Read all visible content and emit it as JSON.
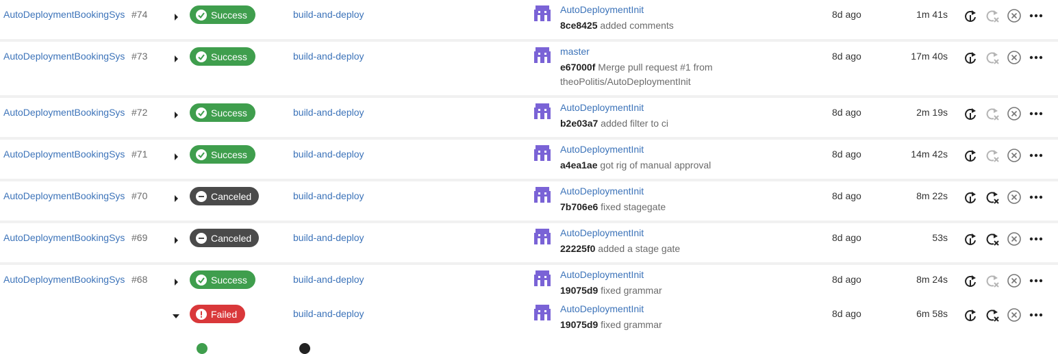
{
  "colors": {
    "link": "#3c73b9",
    "success": "#3f9e4d",
    "canceled": "#4a4a4a",
    "failed": "#d9383a",
    "avatar": "#7a63d6"
  },
  "icons": {
    "expand": "caret-right-icon",
    "collapse": "caret-down-icon",
    "success": "check-circle-icon",
    "canceled": "minus-circle-icon",
    "failed": "exclamation-circle-icon",
    "rerun": "rerun-icon",
    "rerun_failed": "rerun-failed-icon",
    "cancel": "cancel-circle-icon",
    "more": "more-actions-icon",
    "avatar": "pixel-avatar-icon"
  },
  "pipelines": [
    {
      "project": "AutoDeploymentBookingSys",
      "number": "#74",
      "status": "Success",
      "workflow": "build-and-deploy",
      "branch": "AutoDeploymentInit",
      "hash": "8ce8425",
      "message": "added comments",
      "ago": "8d ago",
      "duration": "1m 41s",
      "rerun_failed_enabled": false,
      "expanded": false
    },
    {
      "project": "AutoDeploymentBookingSys",
      "number": "#73",
      "status": "Success",
      "workflow": "build-and-deploy",
      "branch": "master",
      "hash": "e67000f",
      "message": "Merge pull request #1 from theoPolitis/AutoDeploymentInit",
      "ago": "8d ago",
      "duration": "17m 40s",
      "rerun_failed_enabled": false,
      "expanded": false
    },
    {
      "project": "AutoDeploymentBookingSys",
      "number": "#72",
      "status": "Success",
      "workflow": "build-and-deploy",
      "branch": "AutoDeploymentInit",
      "hash": "b2e03a7",
      "message": "added filter to ci",
      "ago": "8d ago",
      "duration": "2m 19s",
      "rerun_failed_enabled": false,
      "expanded": false
    },
    {
      "project": "AutoDeploymentBookingSys",
      "number": "#71",
      "status": "Success",
      "workflow": "build-and-deploy",
      "branch": "AutoDeploymentInit",
      "hash": "a4ea1ae",
      "message": "got rig of manual approval",
      "ago": "8d ago",
      "duration": "14m 42s",
      "rerun_failed_enabled": false,
      "expanded": false
    },
    {
      "project": "AutoDeploymentBookingSys",
      "number": "#70",
      "status": "Canceled",
      "workflow": "build-and-deploy",
      "branch": "AutoDeploymentInit",
      "hash": "7b706e6",
      "message": "fixed stagegate",
      "ago": "8d ago",
      "duration": "8m 22s",
      "rerun_failed_enabled": true,
      "expanded": false
    },
    {
      "project": "AutoDeploymentBookingSys",
      "number": "#69",
      "status": "Canceled",
      "workflow": "build-and-deploy",
      "branch": "AutoDeploymentInit",
      "hash": "22225f0",
      "message": "added a stage gate",
      "ago": "8d ago",
      "duration": "53s",
      "rerun_failed_enabled": true,
      "expanded": false
    },
    {
      "project": "AutoDeploymentBookingSys",
      "number": "#68",
      "status": "Success",
      "workflow": "build-and-deploy",
      "branch": "AutoDeploymentInit",
      "hash": "19075d9",
      "message": "fixed grammar",
      "ago": "8d ago",
      "duration": "8m 24s",
      "rerun_failed_enabled": false,
      "expanded": false
    },
    {
      "project": "",
      "number": "",
      "status": "Failed",
      "workflow": "build-and-deploy",
      "branch": "AutoDeploymentInit",
      "hash": "19075d9",
      "message": "fixed grammar",
      "ago": "8d ago",
      "duration": "6m 58s",
      "rerun_failed_enabled": true,
      "expanded": true
    }
  ]
}
